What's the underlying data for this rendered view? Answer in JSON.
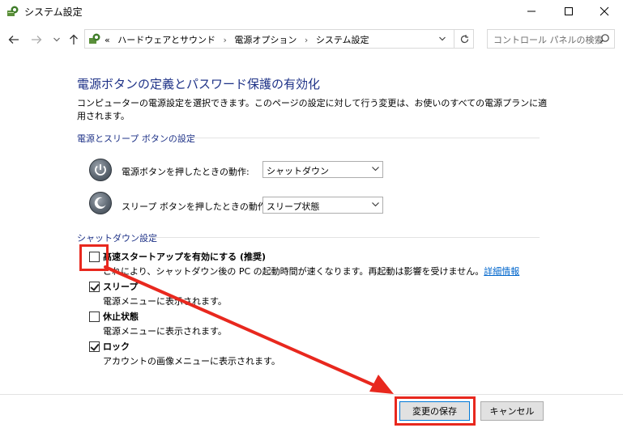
{
  "window": {
    "title": "システム設定",
    "controls": {
      "minimize": "—",
      "maximize": "□",
      "close": "✕"
    }
  },
  "nav": {
    "back_icon": "arrow-left-icon",
    "forward_icon": "arrow-right-icon",
    "recent_icon": "chevron-down-icon",
    "up_icon": "arrow-up-icon"
  },
  "address": {
    "prefix": "«",
    "crumbs": [
      "ハードウェアとサウンド",
      "電源オプション",
      "システム設定"
    ]
  },
  "search": {
    "placeholder": "コントロール パネルの検索"
  },
  "main": {
    "heading": "電源ボタンの定義とパスワード保護の有効化",
    "description": "コンピューターの電源設定を選択できます。このページの設定に対して行う変更は、お使いのすべての電源プランに適用されます。",
    "power_section": {
      "title": "電源とスリープ ボタンの設定",
      "rows": [
        {
          "label": "電源ボタンを押したときの動作:",
          "value": "シャットダウン",
          "icon": "power-icon"
        },
        {
          "label": "スリープ ボタンを押したときの動作:",
          "value": "スリープ状態",
          "icon": "sleep-icon"
        }
      ]
    },
    "shutdown_section": {
      "title": "シャットダウン設定",
      "options": [
        {
          "title": "高速スタートアップを有効にする (推奨)",
          "desc": "これにより、シャットダウン後の PC の起動時間が速くなります。再起動は影響を受けません。",
          "link": "詳細情報",
          "checked": false
        },
        {
          "title": "スリープ",
          "desc": "電源メニューに表示されます。",
          "checked": true
        },
        {
          "title": "休止状態",
          "desc": "電源メニューに表示されます。",
          "checked": false
        },
        {
          "title": "ロック",
          "desc": "アカウントの画像メニューに表示されます。",
          "checked": true
        }
      ]
    }
  },
  "footer": {
    "save_label": "変更の保存",
    "cancel_label": "キャンセル"
  },
  "annotation": {
    "color": "#e8281e"
  }
}
